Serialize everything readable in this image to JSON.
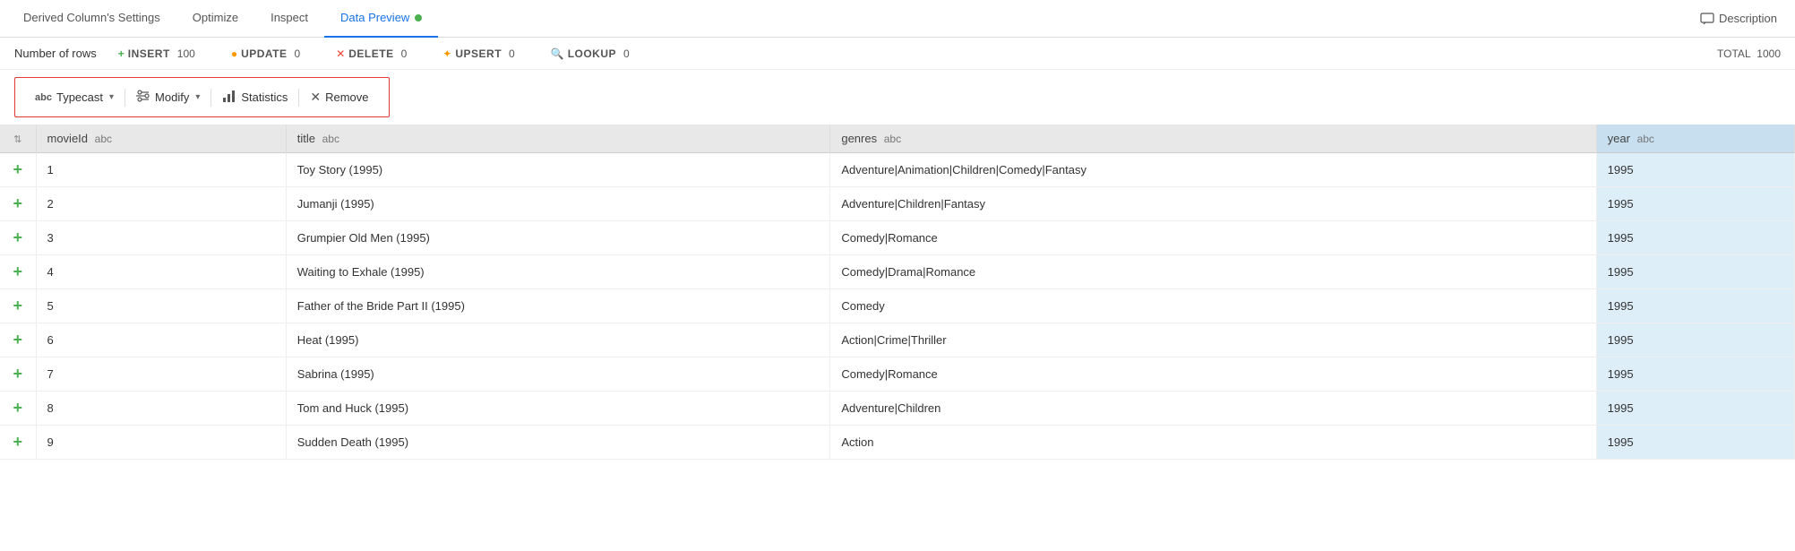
{
  "nav": {
    "tabs": [
      {
        "id": "derived-settings",
        "label": "Derived Column's Settings",
        "active": false
      },
      {
        "id": "optimize",
        "label": "Optimize",
        "active": false
      },
      {
        "id": "inspect",
        "label": "Inspect",
        "active": false
      },
      {
        "id": "data-preview",
        "label": "Data Preview",
        "active": true
      }
    ],
    "description_label": "Description"
  },
  "stats": {
    "number_of_rows_label": "Number of rows",
    "insert_label": "INSERT",
    "insert_count": "100",
    "update_label": "UPDATE",
    "update_count": "0",
    "delete_label": "DELETE",
    "delete_count": "0",
    "upsert_label": "UPSERT",
    "upsert_count": "0",
    "lookup_label": "LOOKUP",
    "lookup_count": "0",
    "total_label": "TOTAL",
    "total_count": "1000"
  },
  "toolbar": {
    "typecast_label": "Typecast",
    "modify_label": "Modify",
    "statistics_label": "Statistics",
    "remove_label": "Remove"
  },
  "table": {
    "columns": [
      {
        "id": "sort",
        "label": "⇅",
        "tag": ""
      },
      {
        "id": "movieId",
        "label": "movieId",
        "tag": "abc"
      },
      {
        "id": "title",
        "label": "title",
        "tag": "abc"
      },
      {
        "id": "genres",
        "label": "genres",
        "tag": "abc"
      },
      {
        "id": "year",
        "label": "year",
        "tag": "abc"
      }
    ],
    "rows": [
      {
        "sort": "+",
        "movieId": "1",
        "title": "Toy Story (1995)",
        "genres": "Adventure|Animation|Children|Comedy|Fantasy",
        "year": "1995"
      },
      {
        "sort": "+",
        "movieId": "2",
        "title": "Jumanji (1995)",
        "genres": "Adventure|Children|Fantasy",
        "year": "1995"
      },
      {
        "sort": "+",
        "movieId": "3",
        "title": "Grumpier Old Men (1995)",
        "genres": "Comedy|Romance",
        "year": "1995"
      },
      {
        "sort": "+",
        "movieId": "4",
        "title": "Waiting to Exhale (1995)",
        "genres": "Comedy|Drama|Romance",
        "year": "1995"
      },
      {
        "sort": "+",
        "movieId": "5",
        "title": "Father of the Bride Part II (1995)",
        "genres": "Comedy",
        "year": "1995"
      },
      {
        "sort": "+",
        "movieId": "6",
        "title": "Heat (1995)",
        "genres": "Action|Crime|Thriller",
        "year": "1995"
      },
      {
        "sort": "+",
        "movieId": "7",
        "title": "Sabrina (1995)",
        "genres": "Comedy|Romance",
        "year": "1995"
      },
      {
        "sort": "+",
        "movieId": "8",
        "title": "Tom and Huck (1995)",
        "genres": "Adventure|Children",
        "year": "1995"
      },
      {
        "sort": "+",
        "movieId": "9",
        "title": "Sudden Death (1995)",
        "genres": "Action",
        "year": "1995"
      }
    ]
  }
}
